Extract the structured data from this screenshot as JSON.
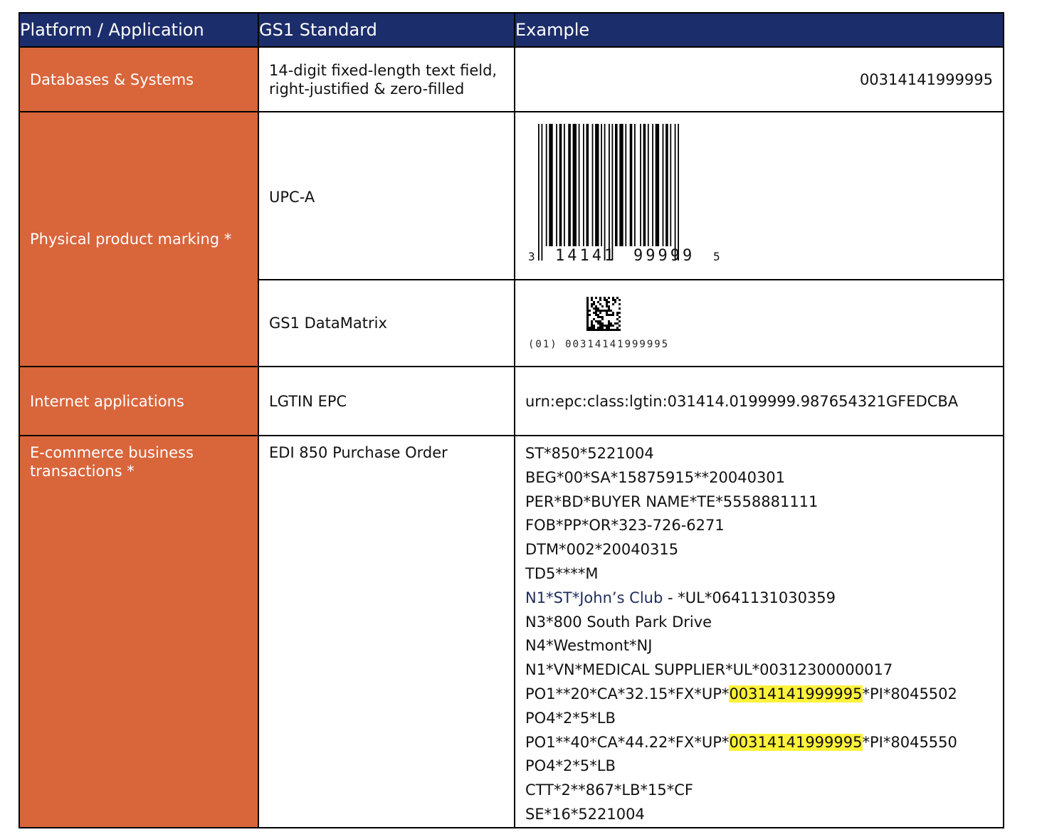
{
  "headers": {
    "platform": "Platform / Application",
    "standard": "GS1 Standard",
    "example": "Example"
  },
  "rows": [
    {
      "platform": "Databases & Systems",
      "standard_lines": [
        "14-digit fixed-length text field,",
        "right-justified & zero-filled"
      ],
      "example": "00314141999995"
    },
    {
      "platform": "Physical product marking *",
      "standard": "UPC-A",
      "barcode_digits": {
        "left": "3",
        "group1": "14141",
        "group2": "99999",
        "right": "5"
      }
    },
    {
      "standard": "GS1 DataMatrix",
      "example": "(01) 00314141999995"
    },
    {
      "platform": "Internet applications",
      "standard": "LGTIN EPC",
      "example": "urn:epc:class:lgtin:031414.0199999.987654321GFEDCBA"
    },
    {
      "platform_lines": [
        "E-commerce business",
        "transactions *"
      ],
      "standard": "EDI 850 Purchase Order",
      "edi_lines": [
        "ST*850*5221004",
        "BEG*00*SA*15875915**20040301",
        "PER*BD*BUYER NAME*TE*5558881111",
        "FOB*PP*OR*323-726-6271",
        "DTM*002*20040315",
        "TD5****M",
        {
          "blue": "N1*ST*John’s Club",
          "rest": " - *UL*0641131030359"
        },
        "N3*800 South Park Drive",
        "N4*Westmont*NJ",
        "N1*VN*MEDICAL SUPPLIER*UL*00312300000017",
        {
          "pre": "PO1**20*CA*32.15*FX*UP*",
          "hl": "00314141999995",
          "post": "*PI*8045502"
        },
        "PO4*2*5*LB",
        {
          "pre": "PO1**40*CA*44.22*FX*UP*",
          "hl": "00314141999995",
          "post": "*PI*8045550"
        },
        "PO4*2*5*LB",
        "CTT*2**867*LB*15*CF",
        "SE*16*5221004"
      ]
    }
  ],
  "colors": {
    "header_bg": "#1c2d6b",
    "platform_bg": "#d9653b",
    "highlight": "#fff23a"
  }
}
